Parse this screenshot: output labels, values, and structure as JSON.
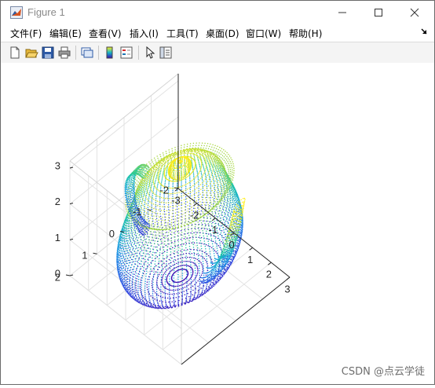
{
  "window": {
    "title": "Figure 1"
  },
  "menu": {
    "items": [
      "文件(F)",
      "编辑(E)",
      "查看(V)",
      "插入(I)",
      "工具(T)",
      "桌面(D)",
      "窗口(W)",
      "帮助(H)"
    ]
  },
  "toolbar": {
    "icons": [
      "new-figure-icon",
      "open-file-icon",
      "save-icon",
      "print-icon",
      "link-plot-icon",
      "colorbar-icon",
      "legend-icon",
      "select-arrow-icon",
      "property-inspector-icon"
    ]
  },
  "colors": {
    "accent": "#0072bd",
    "colormap_low": "#3b0ab0",
    "colormap_high": "#ffff00"
  },
  "chart_data": {
    "type": "scatter",
    "projection": "3d",
    "colormap": "parula-like",
    "x_ticks": [
      "-3",
      "-2",
      "-1",
      "0",
      "1",
      "2",
      "3"
    ],
    "y_ticks": [
      "-2",
      "-1",
      "0",
      "1",
      "2"
    ],
    "z_ticks": [
      "0",
      "1",
      "2",
      "3"
    ],
    "xlim": [
      -3,
      3
    ],
    "ylim": [
      -2,
      2
    ],
    "zlim": [
      0,
      3.2
    ],
    "grid": true
  },
  "watermark": "CSDN @点云学徒"
}
